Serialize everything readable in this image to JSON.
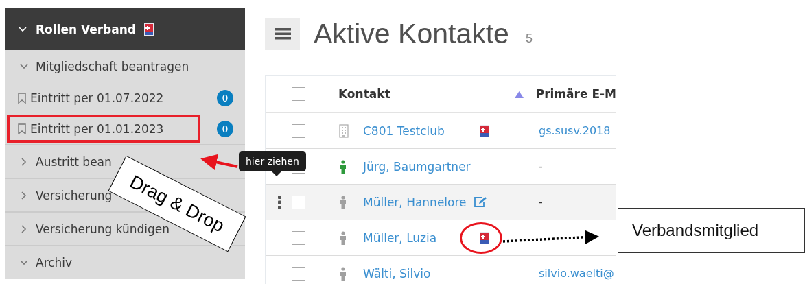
{
  "sidebar": {
    "header": {
      "label": "Rollen Verband",
      "expanded": true
    },
    "groups": [
      {
        "label": "Mitgliedschaft beantragen",
        "expanded": true,
        "children": [
          {
            "label": "Eintritt per 01.07.2022",
            "count": "0",
            "highlighted": false
          },
          {
            "label": "Eintritt per 01.01.2023",
            "count": "0",
            "highlighted": true
          }
        ]
      },
      {
        "label": "Austritt bean",
        "expanded": false
      },
      {
        "label": "Versicherung",
        "expanded": false
      },
      {
        "label": "Versicherung kündigen",
        "expanded": false
      },
      {
        "label": "Archiv",
        "expanded": true
      }
    ]
  },
  "page": {
    "title": "Aktive Kontakte",
    "count": "5"
  },
  "table": {
    "all_checked": false,
    "columns": [
      {
        "label": "Kontakt",
        "sorted": true
      },
      {
        "label": "Primäre E-M"
      }
    ],
    "rows": [
      {
        "kind": "organization",
        "name": "C801 Testclub",
        "checked": false,
        "member": true,
        "circled": false,
        "hovered": false,
        "editable": false,
        "email": "gs.susv.2018"
      },
      {
        "kind": "person",
        "color": "#2e9a3c",
        "name": "Jürg, Baumgartner",
        "checked": false,
        "member": false,
        "circled": false,
        "hovered": false,
        "editable": false,
        "email": "-"
      },
      {
        "kind": "person",
        "color": "#a0a0a0",
        "name": "Müller, Hannelore",
        "checked": false,
        "member": false,
        "circled": false,
        "hovered": true,
        "editable": true,
        "email": "-"
      },
      {
        "kind": "person",
        "color": "#a0a0a0",
        "name": "Müller, Luzia",
        "checked": false,
        "member": true,
        "circled": true,
        "hovered": false,
        "editable": false
      },
      {
        "kind": "person",
        "color": "#a0a0a0",
        "name": "Wälti, Silvio",
        "checked": false,
        "member": false,
        "circled": false,
        "hovered": false,
        "editable": false,
        "email": "silvio.waelti@"
      }
    ]
  },
  "annotations": {
    "tooltip": "hier ziehen",
    "drag_label": "Drag & Drop",
    "callout": "Verbandsmitglied"
  }
}
